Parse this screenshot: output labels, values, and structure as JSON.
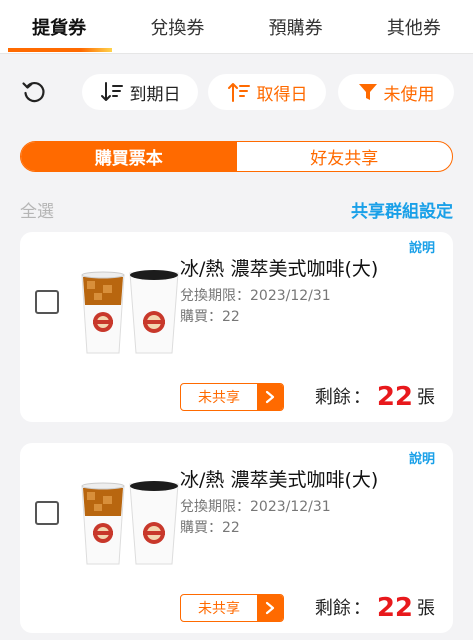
{
  "tabs": [
    {
      "label": "提貨券",
      "active": true
    },
    {
      "label": "兌換券",
      "active": false
    },
    {
      "label": "預購券",
      "active": false
    },
    {
      "label": "其他券",
      "active": false
    }
  ],
  "filters": {
    "sort_due_label": "到期日",
    "sort_acquired_label": "取得日",
    "status_label": "未使用"
  },
  "segment": {
    "active_label": "購買票本",
    "inactive_label": "好友共享"
  },
  "list_header": {
    "select_all_label": "全選",
    "share_group_settings_label": "共享群組設定"
  },
  "cards": [
    {
      "explain_label": "說明",
      "title": "冰/熱 濃萃美式咖啡(大)",
      "expiry": "兌換期限：2023/12/31",
      "purchased": "購買：22",
      "share_status": "未共享",
      "remaining_label": "剩餘",
      "remaining_count": "22",
      "unit": "張"
    },
    {
      "explain_label": "說明",
      "title": "冰/熱 濃萃美式咖啡(大)",
      "expiry": "兌換期限：2023/12/31",
      "purchased": "購買：22",
      "share_status": "未共享",
      "remaining_label": "剩餘",
      "remaining_count": "22",
      "unit": "張"
    }
  ],
  "colors": {
    "accent": "#ff6a00",
    "link": "#1aa0e8",
    "count": "#e8191c"
  }
}
